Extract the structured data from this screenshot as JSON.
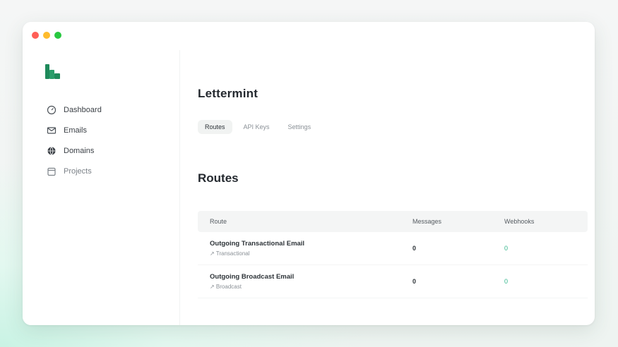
{
  "app": {
    "title": "Lettermint"
  },
  "sidebar": {
    "items": [
      {
        "label": "Dashboard",
        "icon": "dashboard-icon"
      },
      {
        "label": "Emails",
        "icon": "mail-icon"
      },
      {
        "label": "Domains",
        "icon": "globe-icon"
      },
      {
        "label": "Projects",
        "icon": "folder-icon",
        "active": true
      }
    ]
  },
  "tabs": [
    {
      "label": "Routes",
      "active": true
    },
    {
      "label": "API Keys",
      "active": false
    },
    {
      "label": "Settings",
      "active": false
    }
  ],
  "section": {
    "title": "Routes"
  },
  "table": {
    "columns": [
      "Route",
      "Messages",
      "Webhooks"
    ],
    "rows": [
      {
        "name": "Outgoing Transactional Email",
        "sub": "↗ Transactional",
        "messages": "0",
        "webhooks": "0"
      },
      {
        "name": "Outgoing Broadcast Email",
        "sub": "↗ Broadcast",
        "messages": "0",
        "webhooks": "0"
      }
    ]
  },
  "colors": {
    "accent": "#1f8a5b",
    "link": "#2fb489"
  }
}
